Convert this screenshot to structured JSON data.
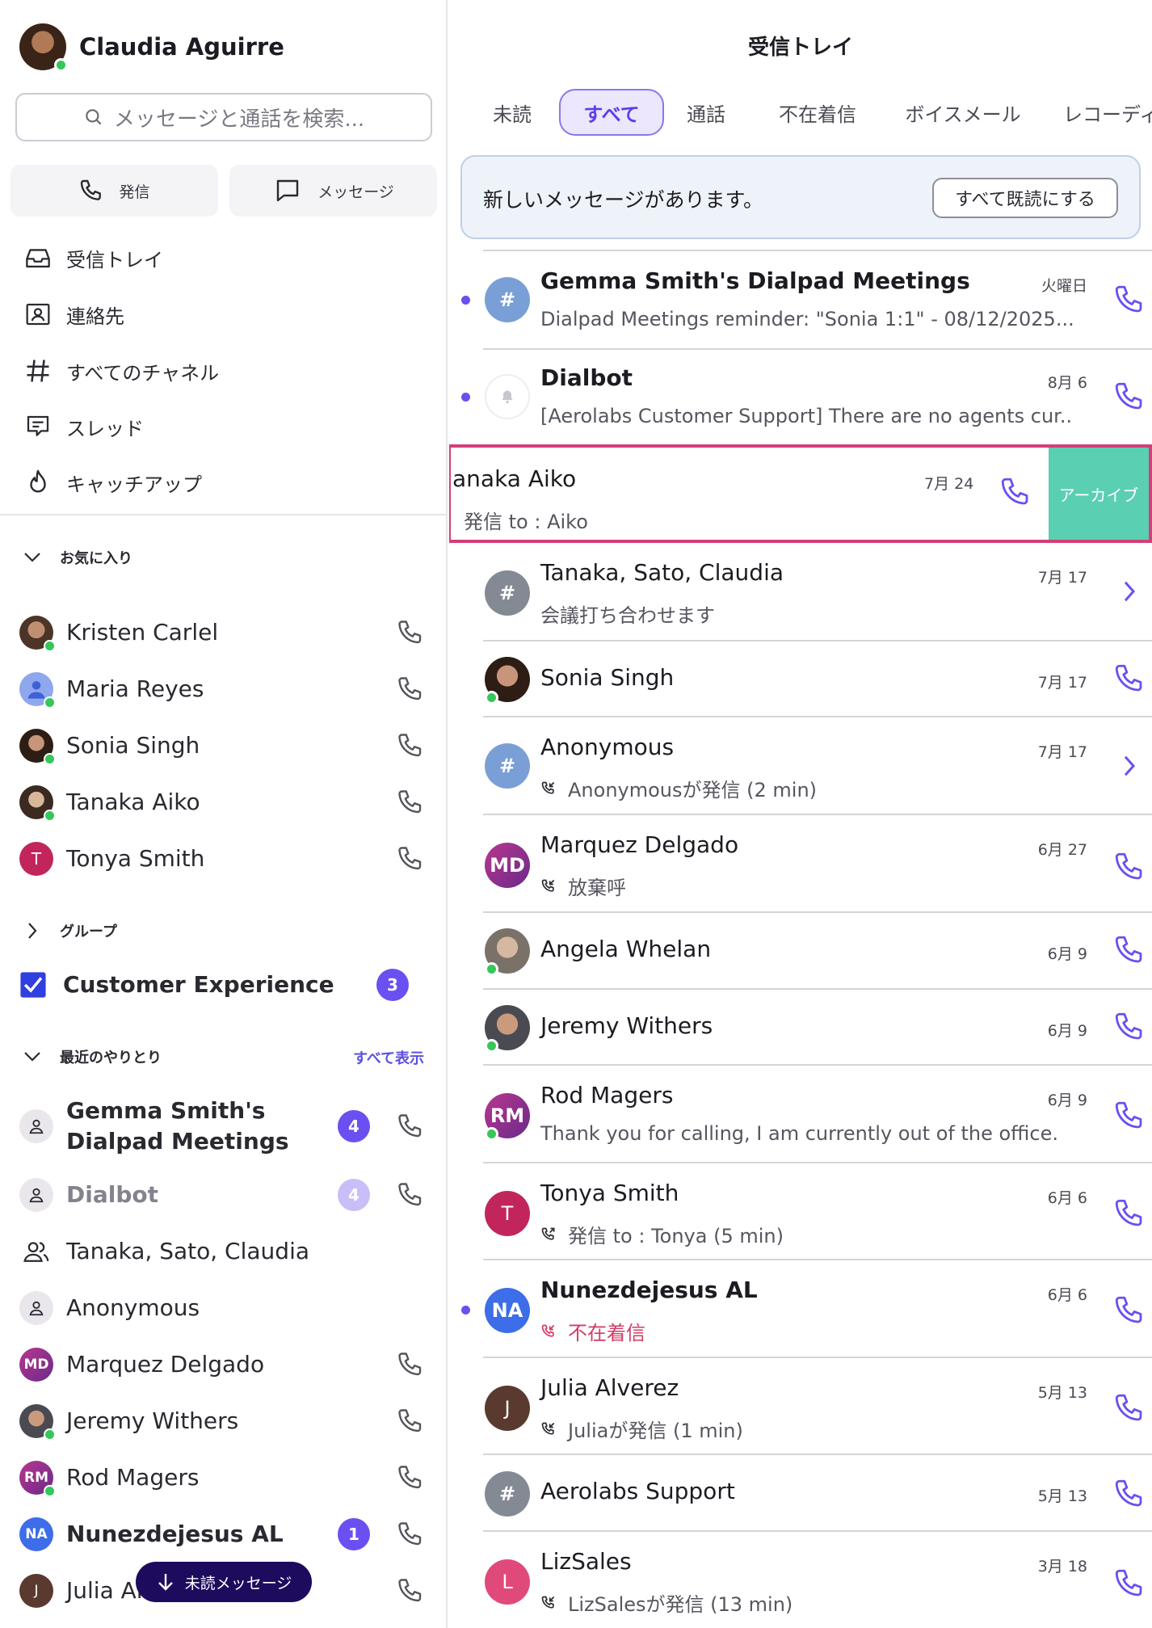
{
  "profile": {
    "name": "Claudia  Aguirre"
  },
  "search": {
    "placeholder": "メッセージと通話を検索..."
  },
  "quick_actions": {
    "call": "発信",
    "message": "メッセージ"
  },
  "nav": [
    {
      "label": "受信トレイ",
      "icon": "inbox-icon"
    },
    {
      "label": "連絡先",
      "icon": "contacts-icon"
    },
    {
      "label": "すべてのチャネル",
      "icon": "hash-icon"
    },
    {
      "label": "スレッド",
      "icon": "threads-icon"
    },
    {
      "label": "キャッチアップ",
      "icon": "flame-icon"
    }
  ],
  "favorites": {
    "heading": "お気に入り",
    "items": [
      {
        "name": "Kristen Carlel",
        "avatar_color": "#8a6a58"
      },
      {
        "name": "Maria Reyes",
        "avatar_color": "#7d95e0"
      },
      {
        "name": "Sonia  Singh",
        "avatar_color": "#6b4a3a"
      },
      {
        "name": "Tanaka Aiko",
        "avatar_color": "#8a7a62"
      },
      {
        "name": "Tonya Smith",
        "initials": "T",
        "avatar_color": "#c2255c"
      }
    ]
  },
  "groups": {
    "heading": "グループ",
    "items": [
      {
        "name": "Customer Experience",
        "badge": "3"
      }
    ]
  },
  "recent": {
    "heading": "最近のやりとり",
    "show_all": "すべて表示",
    "items": [
      {
        "name": "Gemma Smith's Dialpad Meetings",
        "badge": "4"
      },
      {
        "name": "Dialbot",
        "badge": "4"
      },
      {
        "name": "Tanaka, Sato, Claudia"
      },
      {
        "name": "Anonymous"
      },
      {
        "name": "Marquez Delgado",
        "initials": "MD"
      },
      {
        "name": "Jeremy Withers"
      },
      {
        "name": "Rod Magers",
        "initials": "RM"
      },
      {
        "name": "Nunezdejesus AL",
        "initials": "NA",
        "badge": "1"
      },
      {
        "name": "Julia Al",
        "initials": "J"
      }
    ]
  },
  "unread_pill": "未読メッセージ",
  "main": {
    "title": "受信トレイ",
    "tabs": [
      "未読",
      "すべて",
      "通話",
      "不在着信",
      "ボイスメール",
      "レコーディ"
    ],
    "banner": {
      "text": "新しいメッセージがあります。",
      "button": "すべて既読にする"
    },
    "conversations": [
      {
        "title": "Gemma Smith's Dialpad Meetings",
        "subtitle": "Dialpad Meetings reminder: \"Sonia 1:1\" - 08/12/2025...",
        "date": "火曜日"
      },
      {
        "title": "Dialbot",
        "subtitle": "[Aerolabs Customer Support] There are no agents cur...",
        "date": "8月 6"
      },
      {
        "title": "Tanaka, Sato, Claudia",
        "subtitle": "会議打ち合わせます",
        "date": "7月 17"
      },
      {
        "title": "Sonia  Singh",
        "date": "7月 17"
      },
      {
        "title": "Anonymous",
        "subtitle": "Anonymousが発信 (2 min)",
        "date": "7月 17"
      },
      {
        "title": "Marquez Delgado",
        "initials": "MD",
        "subtitle": "放棄呼",
        "date": "6月 27"
      },
      {
        "title": "Angela Whelan",
        "date": "6月 9"
      },
      {
        "title": "Jeremy Withers",
        "date": "6月 9"
      },
      {
        "title": "Rod Magers",
        "initials": "RM",
        "subtitle": "Thank you for calling, I am currently out of the office.",
        "date": "6月 9"
      },
      {
        "title": "Tonya Smith",
        "initials": "T",
        "subtitle": "発信 to : Tonya (5 min)",
        "date": "6月 6"
      },
      {
        "title": "Nunezdejesus AL",
        "initials": "NA",
        "subtitle": "不在着信",
        "date": "6月 6"
      },
      {
        "title": "Julia Alverez",
        "initials": "J",
        "subtitle": "Juliaが発信 (1 min)",
        "date": "5月 13"
      },
      {
        "title": "Aerolabs Support",
        "date": "5月 13"
      },
      {
        "title": "LizSales",
        "initials": "L",
        "subtitle": "LizSalesが発信 (13 min)",
        "date": "3月 18"
      }
    ],
    "swiped": {
      "title": "anaka Aiko",
      "subtitle": "発信 to : Aiko",
      "date": "7月 24",
      "archive": "アーカイブ"
    }
  },
  "colors": {
    "accent": "#6b4ff0",
    "archive": "#5bcfb2",
    "missed": "#d43a63",
    "highlight": "#d33f78"
  }
}
